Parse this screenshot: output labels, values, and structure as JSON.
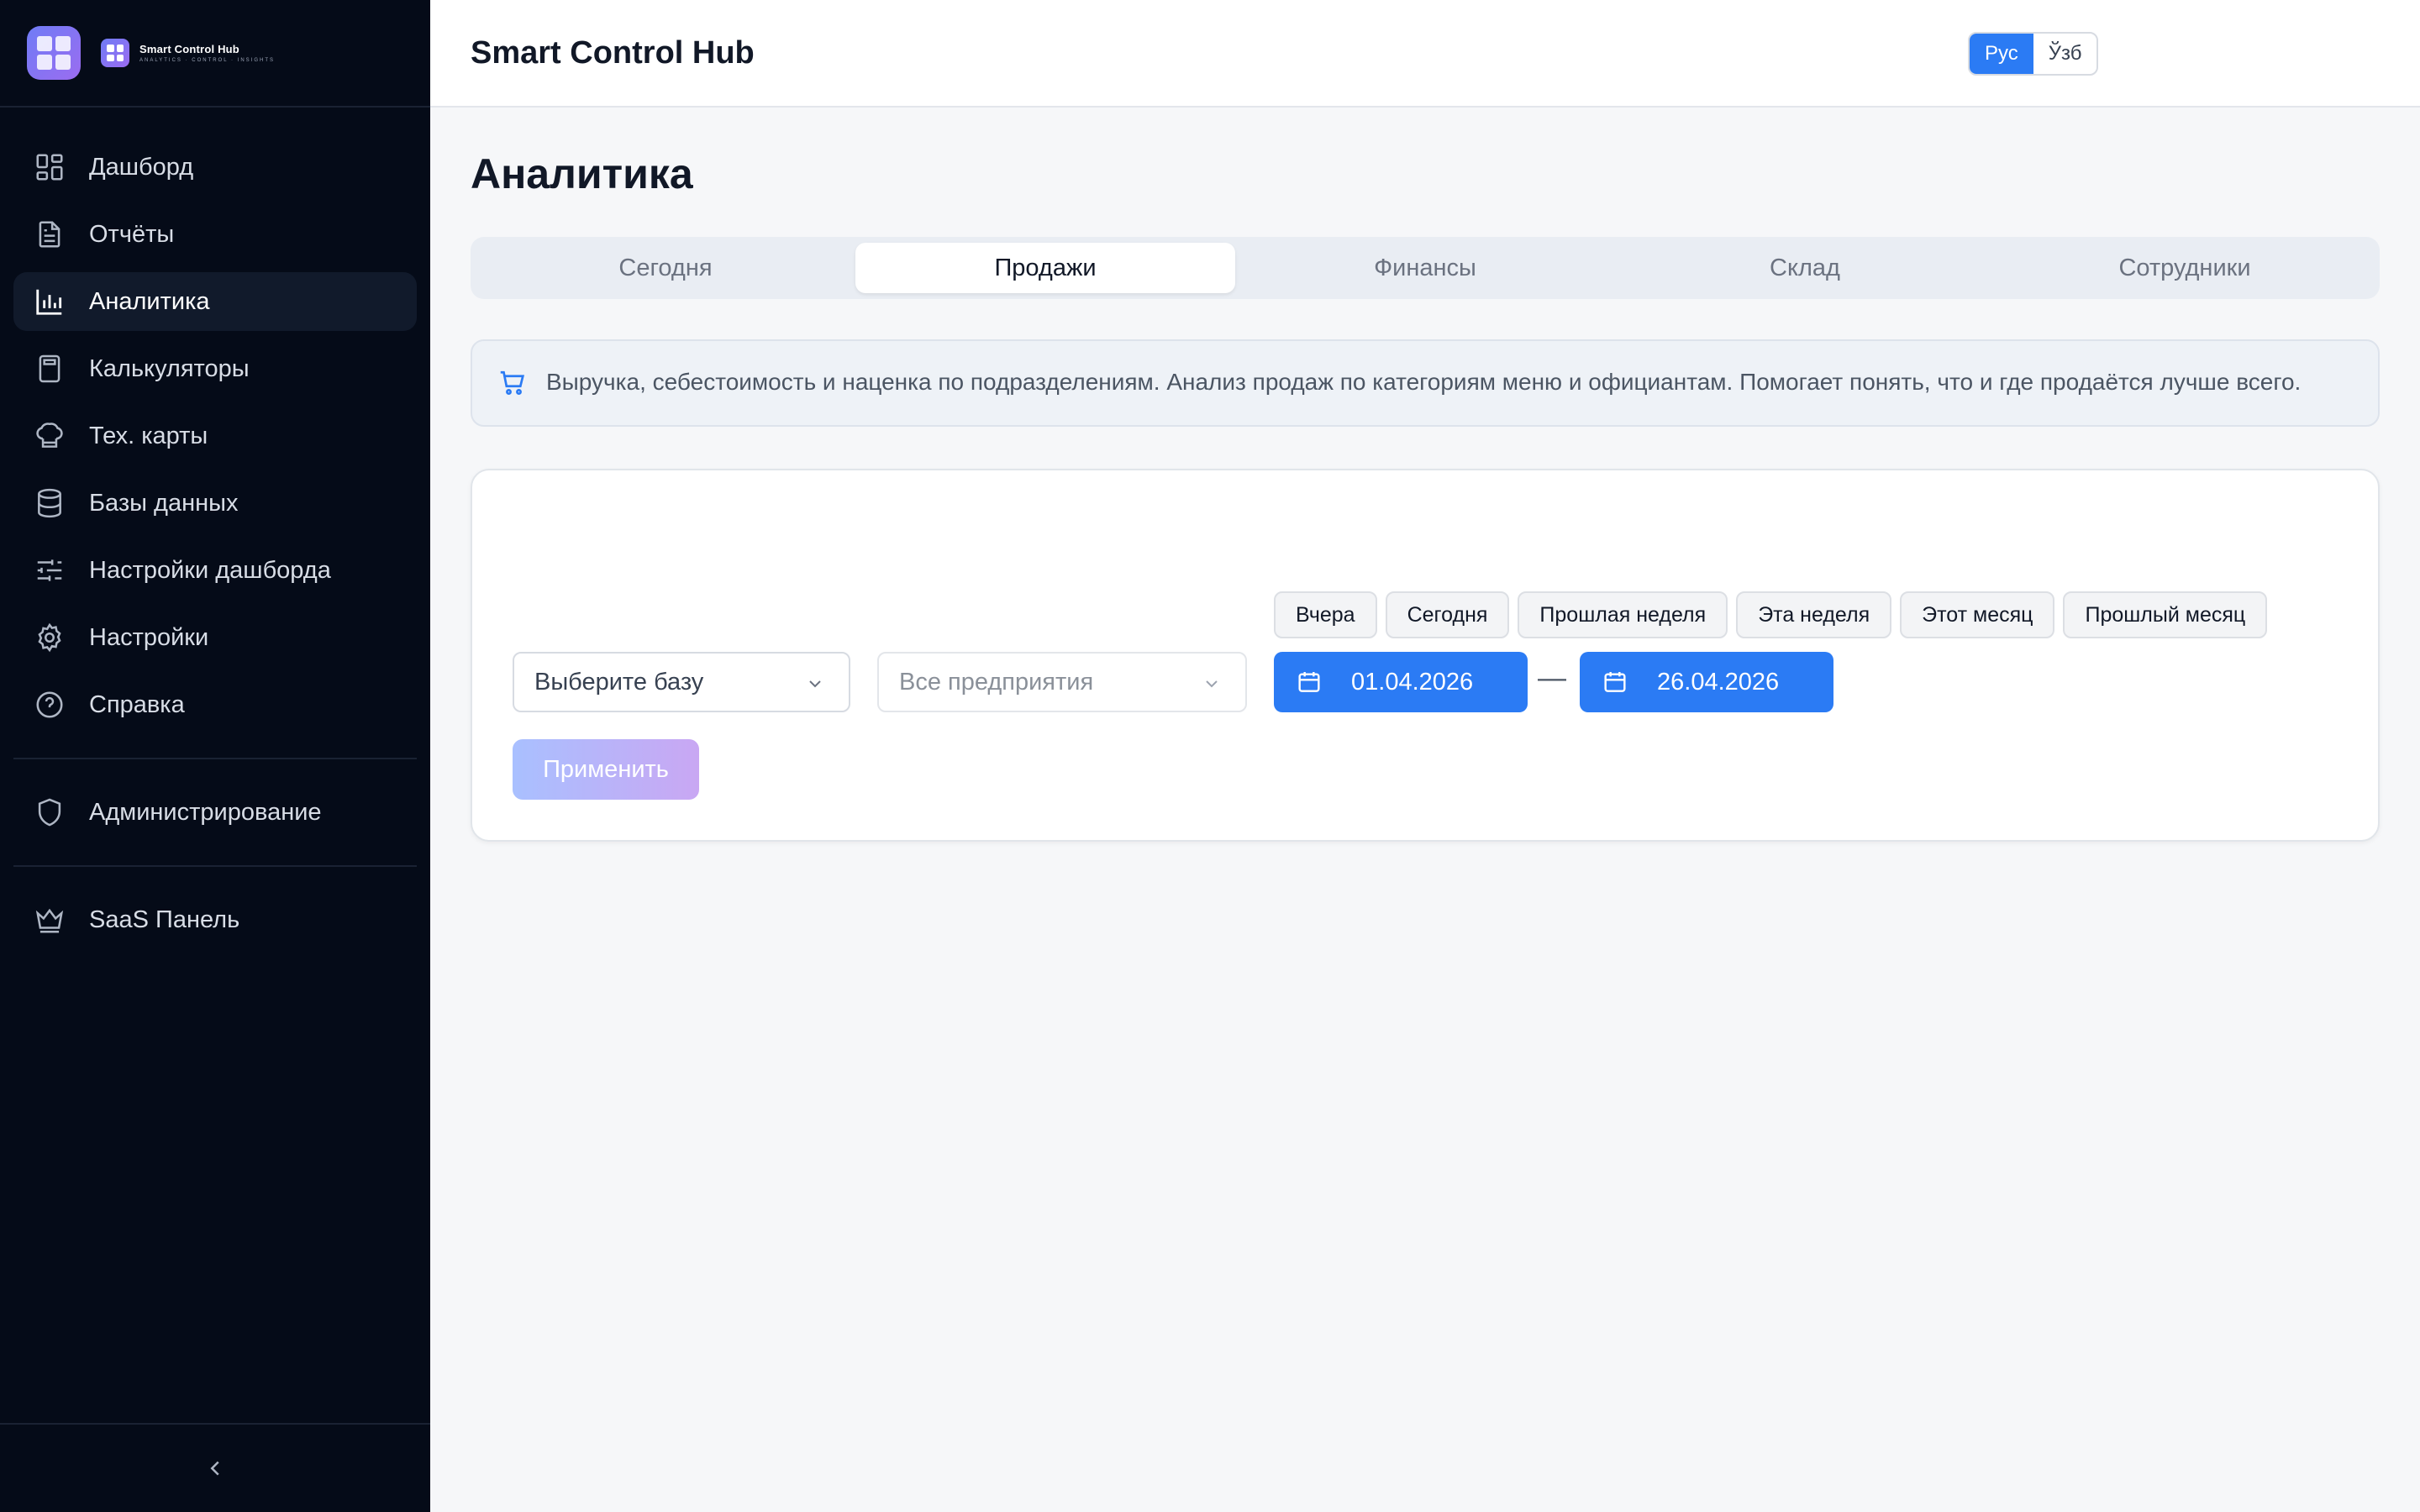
{
  "brand": {
    "name": "Smart Control Hub",
    "tagline": "ANALYTICS · CONTROL · INSIGHTS"
  },
  "sidebar": {
    "items": [
      {
        "label": "Дашборд",
        "icon": "dashboard-icon"
      },
      {
        "label": "Отчёты",
        "icon": "document-icon"
      },
      {
        "label": "Аналитика",
        "icon": "bar-chart-icon",
        "active": true
      },
      {
        "label": "Калькуляторы",
        "icon": "calculator-icon"
      },
      {
        "label": "Тех. карты",
        "icon": "chef-hat-icon"
      },
      {
        "label": "Базы данных",
        "icon": "database-icon"
      },
      {
        "label": "Настройки дашборда",
        "icon": "sliders-icon"
      },
      {
        "label": "Настройки",
        "icon": "gear-icon"
      },
      {
        "label": "Справка",
        "icon": "help-circle-icon"
      }
    ],
    "admin": {
      "label": "Администрирование",
      "icon": "shield-icon"
    },
    "saas": {
      "label": "SaaS Панель",
      "icon": "crown-icon"
    }
  },
  "header": {
    "title": "Smart Control Hub",
    "lang": [
      "Рус",
      "Ўзб"
    ],
    "lang_active": "Рус"
  },
  "page": {
    "title": "Аналитика",
    "tabs": [
      "Сегодня",
      "Продажи",
      "Финансы",
      "Склад",
      "Сотрудники"
    ],
    "active_tab": "Продажи",
    "info": "Выручка, себестоимость и наценка по подразделениям. Анализ продаж по категориям меню и официантам. Помогает понять, что и где продаётся лучше всего."
  },
  "filters": {
    "db_select": "Выберите базу",
    "enterprise_select": "Все предприятия",
    "presets": [
      "Вчера",
      "Сегодня",
      "Прошлая неделя",
      "Эта неделя",
      "Этот месяц",
      "Прошлый месяц"
    ],
    "date_from": "01.04.2026",
    "date_to": "26.04.2026",
    "dash": "—",
    "apply": "Применить"
  },
  "colors": {
    "sidebar_bg": "#050b18",
    "accent": "#2b7bf4",
    "apply_gradient_start": "#a9c0ff",
    "apply_gradient_end": "#c9a7f3"
  }
}
